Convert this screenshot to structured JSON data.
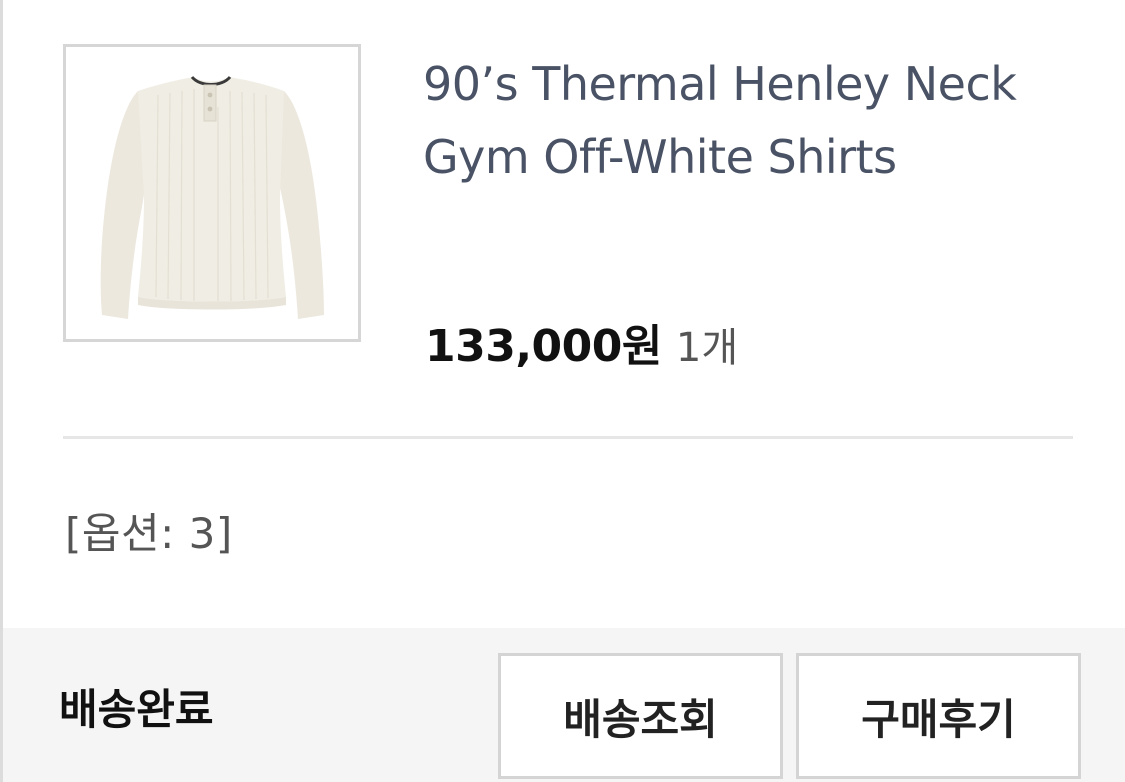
{
  "product": {
    "title": "90’s Thermal Henley Neck Gym Off-White Shirts",
    "price": "133,000원",
    "quantity": "1개",
    "option": "[옵션: 3]"
  },
  "order": {
    "status": "배송완료",
    "track_label": "배송조회",
    "review_label": "구매후기"
  },
  "colors": {
    "title": "#4a5366",
    "garment": "#efece2",
    "footer_bg": "#f5f5f5"
  },
  "icons": {
    "thumbnail": "henley-shirt-image"
  }
}
